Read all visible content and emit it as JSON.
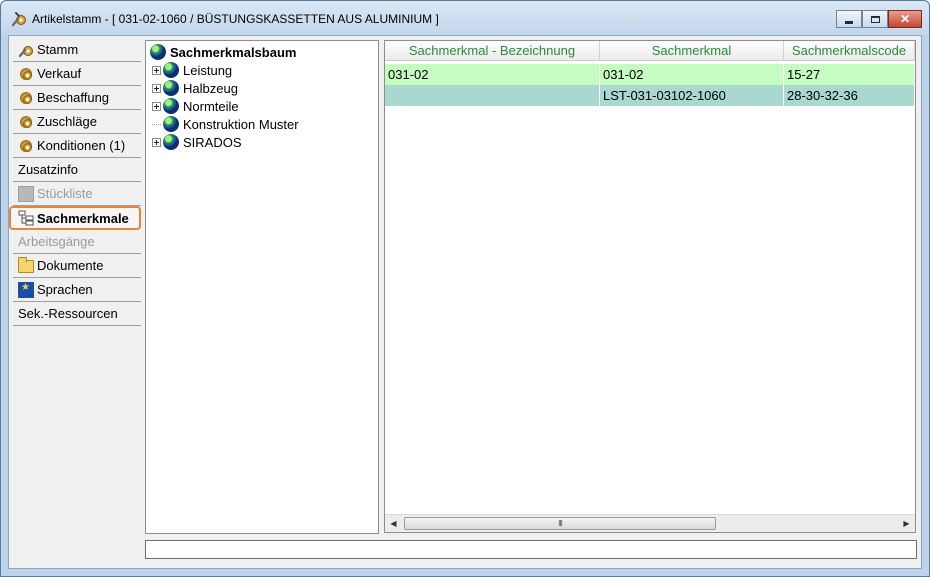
{
  "window": {
    "title": "Artikelstamm - [ 031-02-1060 / BÜSTUNGSKASSETTEN AUS ALUMINIUM ]",
    "title_icon": "wrench-gear-icon",
    "buttons": [
      "minimize",
      "maximize",
      "close"
    ]
  },
  "nav": {
    "items": [
      {
        "label": "Stamm",
        "icon": "wrench-gear-icon",
        "state": "normal"
      },
      {
        "label": "Verkauf",
        "icon": "gear-icon",
        "state": "normal"
      },
      {
        "label": "Beschaffung",
        "icon": "gear-icon",
        "state": "normal"
      },
      {
        "label": "Zuschläge",
        "icon": "gear-icon",
        "state": "normal"
      },
      {
        "label": "Konditionen (1)",
        "icon": "gear-icon",
        "state": "normal"
      },
      {
        "label": "Zusatzinfo",
        "icon": "",
        "state": "normal"
      },
      {
        "label": "Stückliste",
        "icon": "grey-square-icon",
        "state": "disabled"
      },
      {
        "label": "Sachmerkmale",
        "icon": "tree-structure-icon",
        "state": "active"
      },
      {
        "label": "Arbeitsgänge",
        "icon": "",
        "state": "disabled"
      },
      {
        "label": "Dokumente",
        "icon": "folder-icon",
        "state": "normal"
      },
      {
        "label": "Sprachen",
        "icon": "eu-flag-icon",
        "state": "normal"
      },
      {
        "label": "Sek.-Ressourcen",
        "icon": "",
        "state": "normal"
      }
    ]
  },
  "tree": {
    "root": "Sachmerkmalsbaum",
    "nodes": [
      {
        "label": "Leistung",
        "expandable": true
      },
      {
        "label": "Halbzeug",
        "expandable": true
      },
      {
        "label": "Normteile",
        "expandable": true
      },
      {
        "label": "Konstruktion Muster",
        "expandable": false
      },
      {
        "label": "SIRADOS",
        "expandable": true
      }
    ]
  },
  "grid": {
    "columns": [
      "Sachmerkmal - Bezeichnung",
      "Sachmerkmal",
      "Sachmerkmalscode"
    ],
    "rows": [
      {
        "cells": [
          "031-02",
          "031-02",
          "15-27"
        ],
        "color": "#c6fdc0"
      },
      {
        "cells": [
          "",
          "LST-031-03102-1060",
          "28-30-32-36"
        ],
        "color": "#a8d8cf"
      }
    ],
    "scroll_grip": "III"
  },
  "status": {
    "text": ""
  }
}
